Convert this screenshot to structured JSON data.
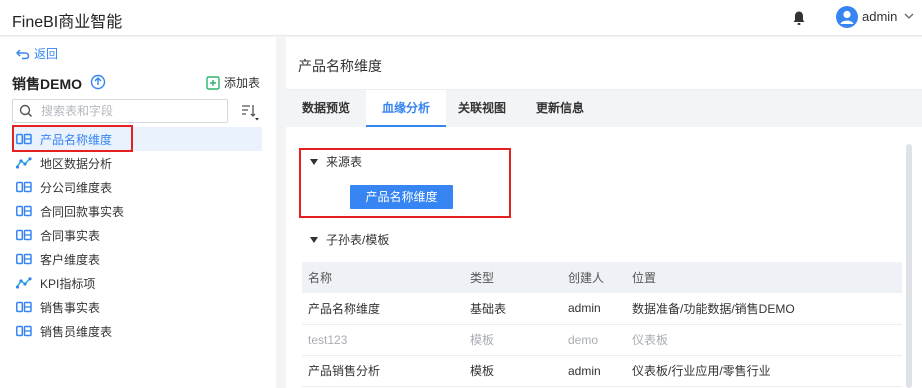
{
  "app": {
    "title": "FineBI商业智能",
    "user": "admin"
  },
  "sidebar": {
    "back_label": "返回",
    "package_title": "销售DEMO",
    "add_table_label": "添加表",
    "search_placeholder": "搜索表和字段",
    "items": [
      {
        "label": "产品名称维度",
        "icon": "db-table-icon",
        "active": true
      },
      {
        "label": "地区数据分析",
        "icon": "analysis-icon",
        "active": false
      },
      {
        "label": "分公司维度表",
        "icon": "db-table-icon",
        "active": false
      },
      {
        "label": "合同回款事实表",
        "icon": "db-table-icon",
        "active": false
      },
      {
        "label": "合同事实表",
        "icon": "db-table-icon",
        "active": false
      },
      {
        "label": "客户维度表",
        "icon": "db-table-icon",
        "active": false
      },
      {
        "label": "KPI指标项",
        "icon": "analysis-icon",
        "active": false
      },
      {
        "label": "销售事实表",
        "icon": "db-table-icon",
        "active": false
      },
      {
        "label": "销售员维度表",
        "icon": "db-table-icon",
        "active": false
      }
    ]
  },
  "main": {
    "title": "产品名称维度",
    "tabs": [
      {
        "label": "数据预览",
        "active": false
      },
      {
        "label": "血缘分析",
        "active": true
      },
      {
        "label": "关联视图",
        "active": false
      },
      {
        "label": "更新信息",
        "active": false
      }
    ],
    "source_section": {
      "label": "来源表",
      "button": "产品名称维度"
    },
    "child_section": {
      "label": "子孙表/模板"
    },
    "table": {
      "headers": [
        "名称",
        "类型",
        "创建人",
        "位置"
      ],
      "rows": [
        {
          "cells": [
            "产品名称维度",
            "基础表",
            "admin",
            "数据准备/功能数据/销售DEMO"
          ],
          "muted": false
        },
        {
          "cells": [
            "test123",
            "模板",
            "demo",
            "仪表板"
          ],
          "muted": true
        },
        {
          "cells": [
            "产品销售分析",
            "模板",
            "admin",
            "仪表板/行业应用/零售行业"
          ],
          "muted": false
        }
      ]
    }
  },
  "colors": {
    "accent": "#3685f2",
    "highlight": "#e52021"
  }
}
